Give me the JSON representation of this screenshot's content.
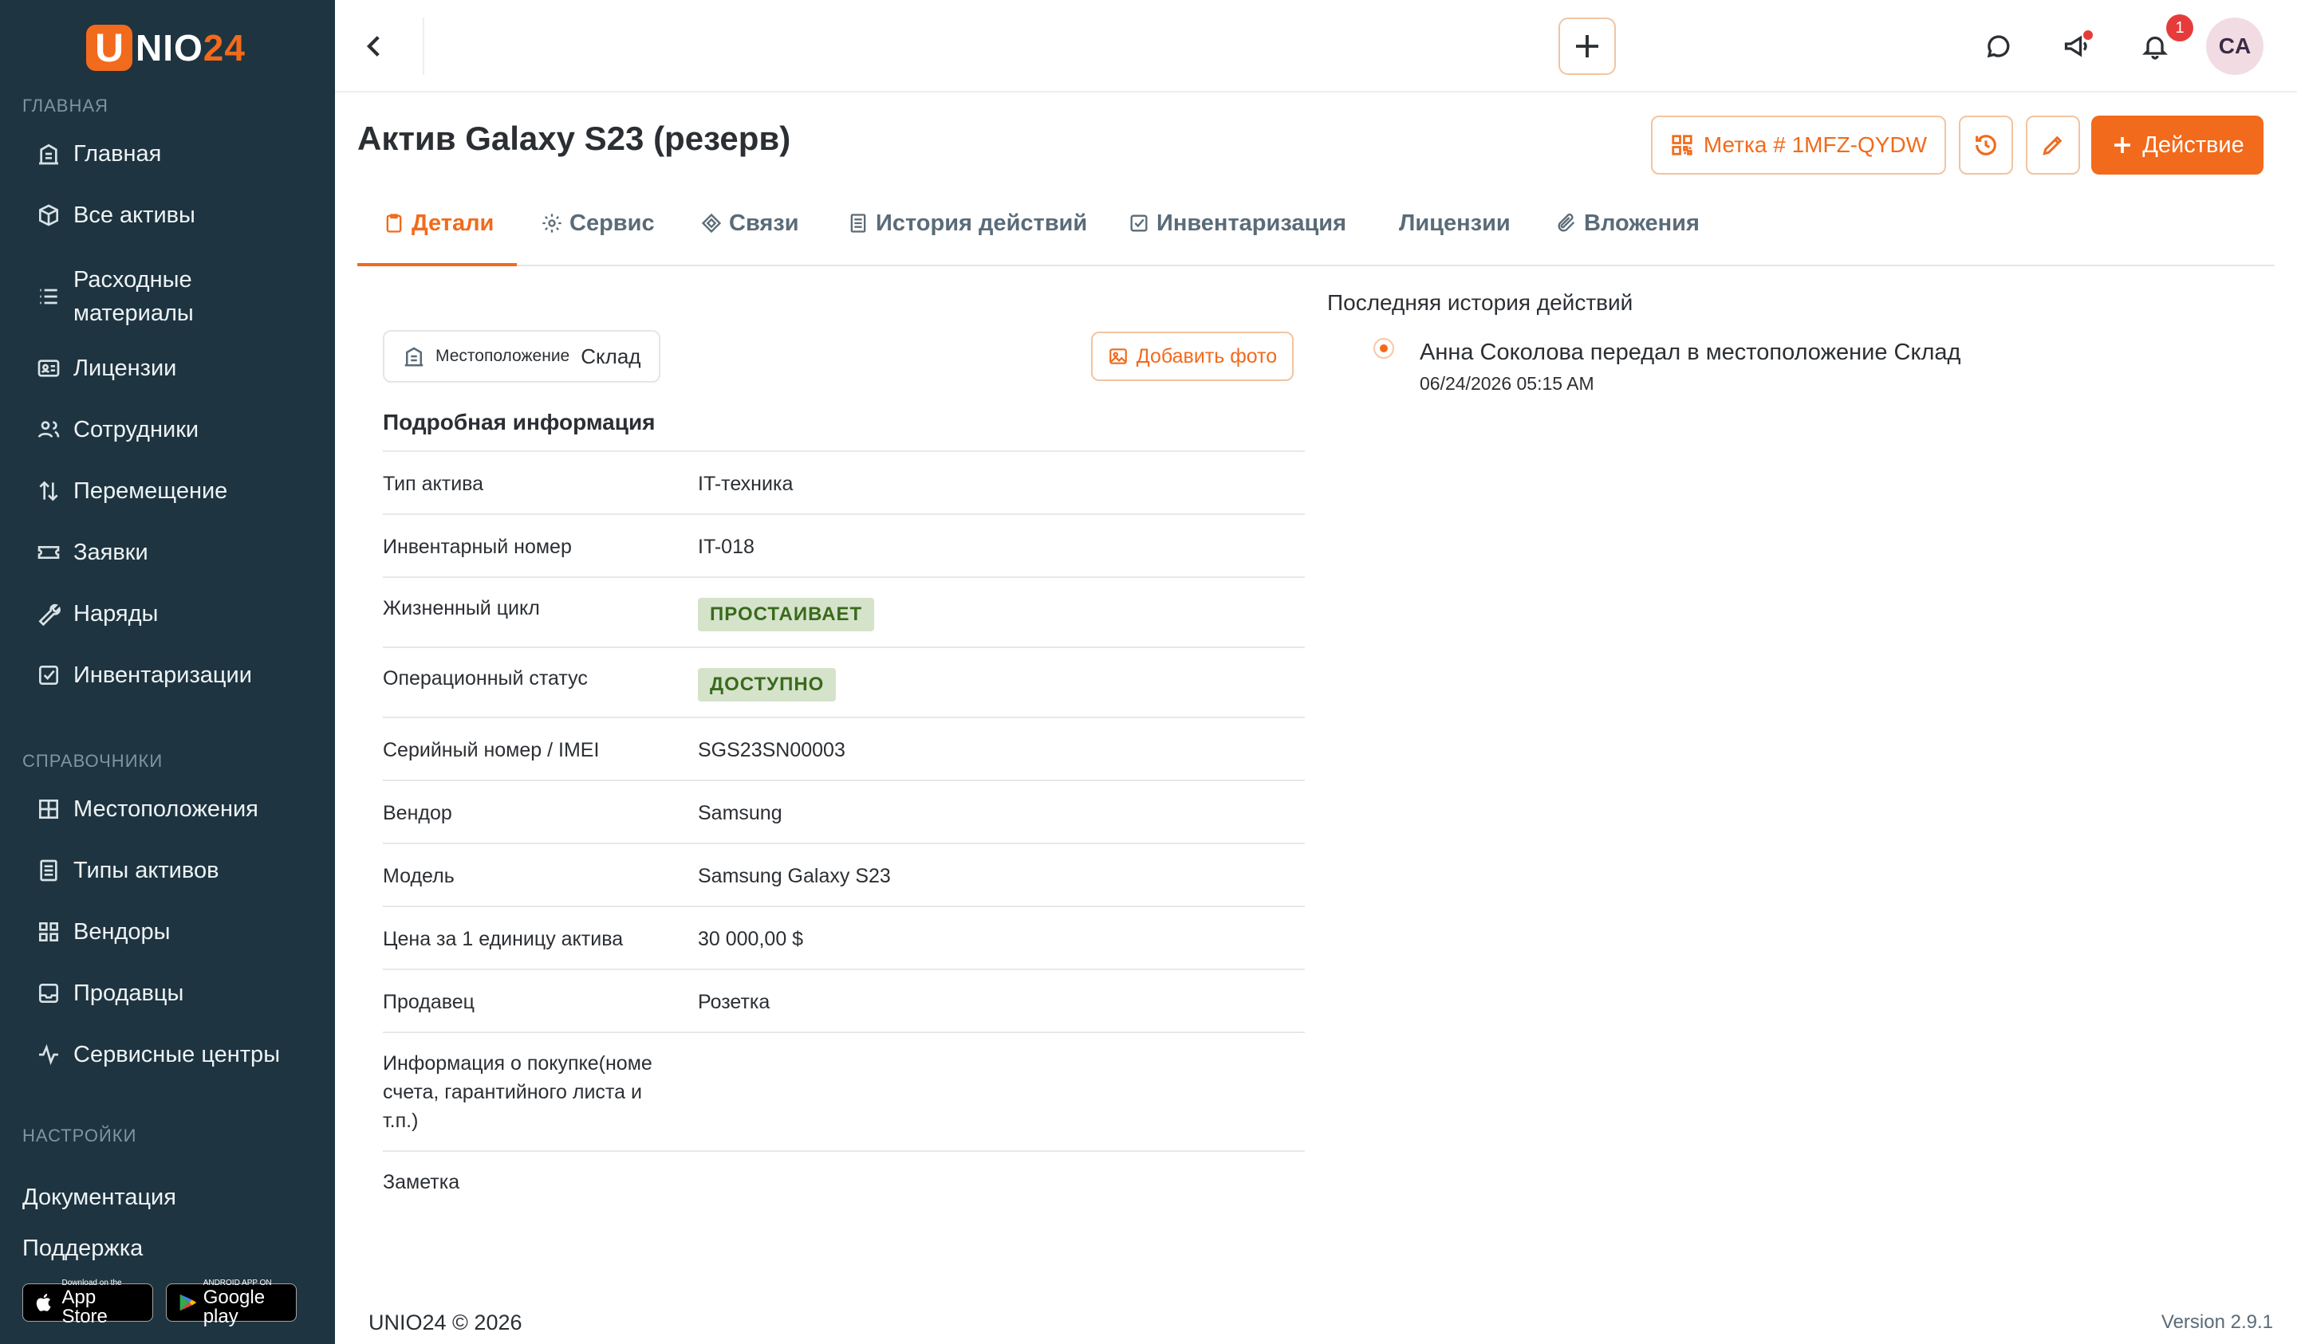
{
  "app": {
    "logo_letter": "U",
    "logo_text_1": "NIO",
    "logo_text_2": "24",
    "brand_color": "#f26a1b",
    "sidebar_color": "#1e3440"
  },
  "sidebar": {
    "section_main": "ГЛАВНАЯ",
    "section_refs": "СПРАВОЧНИКИ",
    "section_settings": "НАСТРОЙКИ",
    "main_items": [
      {
        "label": "Главная",
        "icon": "building-icon"
      },
      {
        "label": "Все активы",
        "icon": "box-icon"
      },
      {
        "label": "Расходные материалы",
        "icon": "list-icon"
      },
      {
        "label": "Лицензии",
        "icon": "id-card-icon"
      },
      {
        "label": "Сотрудники",
        "icon": "users-icon"
      },
      {
        "label": "Перемещение",
        "icon": "transfer-icon"
      },
      {
        "label": "Заявки",
        "icon": "ticket-icon"
      },
      {
        "label": "Наряды",
        "icon": "wrench-icon"
      },
      {
        "label": "Инвентаризации",
        "icon": "checkbox-icon"
      }
    ],
    "ref_items": [
      {
        "label": "Местоположения",
        "icon": "grid-icon"
      },
      {
        "label": "Типы активов",
        "icon": "document-icon"
      },
      {
        "label": "Вендоры",
        "icon": "apps-icon"
      },
      {
        "label": "Продавцы",
        "icon": "inbox-icon"
      },
      {
        "label": "Сервисные центры",
        "icon": "activity-icon"
      }
    ],
    "docs": "Документация",
    "support": "Поддержка",
    "app_store_small": "Download on the",
    "app_store_big": "App Store",
    "google_small": "ANDROID APP ON",
    "google_big": "Google play"
  },
  "topbar": {
    "notification_count": "1",
    "avatar_initials": "CA"
  },
  "page": {
    "title": "Актив Galaxy S23 (резерв)",
    "tag_button": "Метка # 1MFZ-QYDW",
    "action_button": "Действие"
  },
  "tabs": [
    {
      "label": "Детали",
      "icon": "clipboard-icon",
      "active": true
    },
    {
      "label": "Сервис",
      "icon": "gear-icon",
      "active": false
    },
    {
      "label": "Связи",
      "icon": "diamond-icon",
      "active": false
    },
    {
      "label": "История действий",
      "icon": "document-icon",
      "active": false
    },
    {
      "label": "Инвентаризация",
      "icon": "checkbox-icon",
      "active": false
    },
    {
      "label": "Лицензии",
      "icon": "",
      "active": false
    },
    {
      "label": "Вложения",
      "icon": "paperclip-icon",
      "active": false
    }
  ],
  "location": {
    "label": "Местоположение",
    "value": "Склад"
  },
  "add_photo": "Добавить фото",
  "details": {
    "title": "Подробная информация",
    "rows": [
      {
        "label": "Тип актива",
        "value": "IT-техника"
      },
      {
        "label": "Инвентарный номер",
        "value": "IT-018"
      },
      {
        "label": "Жизненный цикл",
        "value": "ПРОСТАИВАЕТ"
      },
      {
        "label": "Операционный статус",
        "value": "ДОСТУПНО"
      },
      {
        "label": "Серийный номер / IMEI",
        "value": "SGS23SN00003"
      },
      {
        "label": "Вендор",
        "value": "Samsung"
      },
      {
        "label": "Модель",
        "value": "Samsung Galaxy S23"
      },
      {
        "label": "Цена за 1 единицу актива",
        "value": "30 000,00 $"
      },
      {
        "label": "Продавец",
        "value": "Розетка"
      },
      {
        "label": "Информация о покупке(номе счета, гарантийного листа и т.п.)",
        "value": ""
      },
      {
        "label": "Заметка",
        "value": ""
      }
    ]
  },
  "history": {
    "title": "Последняя история действий",
    "entries": [
      {
        "text": "Анна Соколова передал в местоположение Склад",
        "time": "06/24/2026 05:15 AM"
      }
    ]
  },
  "footer": {
    "copyright": "UNIO24 © 2026",
    "version": "Version 2.9.1"
  }
}
